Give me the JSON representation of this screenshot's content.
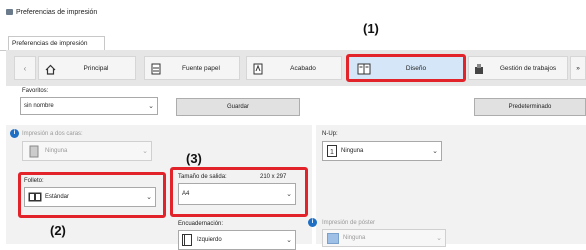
{
  "window": {
    "title": "Preferencias de impresión"
  },
  "tabs": [
    {
      "label": "Preferencias de impresión"
    }
  ],
  "nav": {
    "items": [
      {
        "label": "Principal"
      },
      {
        "label": "Fuente papel"
      },
      {
        "label": "Acabado"
      },
      {
        "label": "Diseño"
      },
      {
        "label": "Gestión de trabajos"
      }
    ],
    "more": "»"
  },
  "favorites": {
    "label": "Favoritos:",
    "value": "sin nombre",
    "save_button": "Guardar",
    "default_button": "Predeterminado"
  },
  "duplex": {
    "label": "Impresión a dos caras:",
    "value": "Ninguna"
  },
  "booklet": {
    "label": "Folleto:",
    "value": "Estándar"
  },
  "output_size": {
    "label": "Tamaño de salida:",
    "info": "210 x 297",
    "value": "A4"
  },
  "binding": {
    "label": "Encuadernación:",
    "value": "Izquierdo"
  },
  "nup": {
    "label": "N-Up:",
    "value": "Ninguna"
  },
  "poster": {
    "label": "Impresión de póster",
    "value": "Ninguna"
  },
  "callouts": {
    "c1": "(1)",
    "c2": "(2)",
    "c3": "(3)"
  },
  "colors": {
    "highlight": "#e2232a",
    "selected_tab": "#d4e6f7",
    "info_icon": "#1f6fc4"
  }
}
